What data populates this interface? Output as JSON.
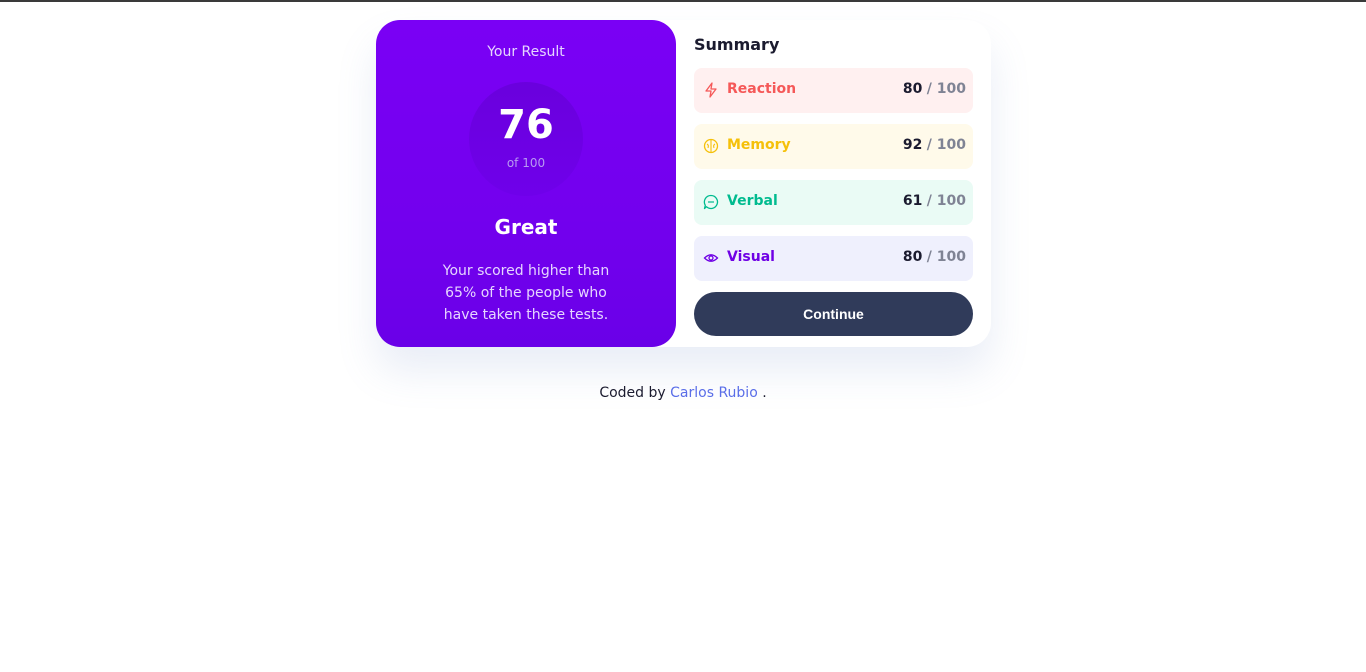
{
  "result": {
    "title": "Your Result",
    "score": "76",
    "score_of": "of 100",
    "rating": "Great",
    "description": "Your scored higher than 65% of the people who have taken these tests."
  },
  "summary": {
    "title": "Summary",
    "items": [
      {
        "label": "Reaction",
        "score": "80",
        "max": "/ 100",
        "icon": "lightning-icon",
        "color": "#f55858",
        "bg": "#fff0f0"
      },
      {
        "label": "Memory",
        "score": "92",
        "max": "/ 100",
        "icon": "brain-icon",
        "color": "#f5c00a",
        "bg": "#fffaea"
      },
      {
        "label": "Verbal",
        "score": "61",
        "max": "/ 100",
        "icon": "chat-bubble-icon",
        "color": "#00bb8f",
        "bg": "#eafbf5"
      },
      {
        "label": "Visual",
        "score": "80",
        "max": "/ 100",
        "icon": "eye-icon",
        "color": "#6f00e5",
        "bg": "#eff0fd"
      }
    ],
    "continue_label": "Continue"
  },
  "footer": {
    "prefix": "Coded by",
    "author": "Carlos Rubio",
    "suffix": "."
  }
}
